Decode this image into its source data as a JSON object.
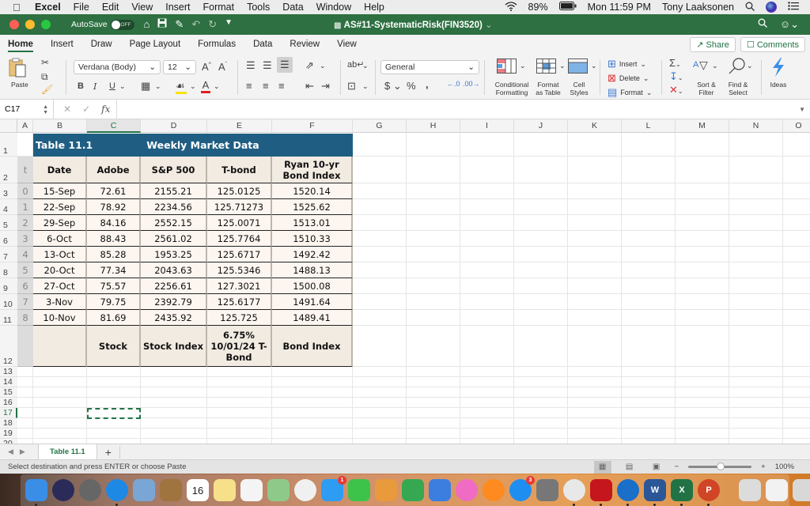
{
  "menubar": {
    "app": "Excel",
    "items": [
      "File",
      "Edit",
      "View",
      "Insert",
      "Format",
      "Tools",
      "Data",
      "Window",
      "Help"
    ],
    "battery": "89%",
    "clock": "Mon 11:59 PM",
    "user": "Tony Laaksonen"
  },
  "titlebar": {
    "autosave_label": "AutoSave",
    "autosave_state": "OFF",
    "document_title": "AS#11-SystematicRisk(FIN3520)"
  },
  "ribbon": {
    "tabs": [
      "Home",
      "Insert",
      "Draw",
      "Page Layout",
      "Formulas",
      "Data",
      "Review",
      "View"
    ],
    "active_tab": "Home",
    "share_label": "Share",
    "comments_label": "Comments",
    "paste_label": "Paste",
    "font_name": "Verdana (Body)",
    "font_size": "12",
    "number_format": "General",
    "conditional_formatting": "Conditional Formatting",
    "format_as_table": "Format as Table",
    "cell_styles": "Cell Styles",
    "insert_label": "Insert",
    "delete_label": "Delete",
    "format_label": "Format",
    "sort_filter": "Sort & Filter",
    "find_select": "Find & Select",
    "ideas": "Ideas",
    "colors": {
      "highlight": "#f5e400",
      "font_color": "#e02020"
    }
  },
  "formula_bar": {
    "name_box": "C17",
    "fx": "fx",
    "content": ""
  },
  "grid": {
    "columns": [
      "A",
      "B",
      "C",
      "D",
      "E",
      "F",
      "G",
      "H",
      "I",
      "J",
      "K",
      "L",
      "M",
      "N",
      "O"
    ],
    "active_column": "C",
    "rows": [
      "1",
      "2",
      "3",
      "4",
      "5",
      "6",
      "7",
      "8",
      "9",
      "10",
      "11",
      "12",
      "13",
      "14",
      "15",
      "16",
      "17",
      "18",
      "19",
      "20"
    ],
    "active_row": "17",
    "selected_cell": "C17"
  },
  "table": {
    "title_left": "Table 11.1",
    "title_right": "Weekly Market Data",
    "headers": [
      "t",
      "Date",
      "Adobe",
      "S&P 500",
      "T-bond",
      "Ryan 10-yr Bond Index"
    ],
    "rows": [
      [
        "0",
        "15-Sep",
        "72.61",
        "2155.21",
        "125.0125",
        "1520.14"
      ],
      [
        "1",
        "22-Sep",
        "78.92",
        "2234.56",
        "125.71273",
        "1525.62"
      ],
      [
        "2",
        "29-Sep",
        "84.16",
        "2552.15",
        "125.0071",
        "1513.01"
      ],
      [
        "3",
        "6-Oct",
        "88.43",
        "2561.02",
        "125.7764",
        "1510.33"
      ],
      [
        "4",
        "13-Oct",
        "85.28",
        "1953.25",
        "125.6717",
        "1492.42"
      ],
      [
        "5",
        "20-Oct",
        "77.34",
        "2043.63",
        "125.5346",
        "1488.13"
      ],
      [
        "6",
        "27-Oct",
        "75.57",
        "2256.61",
        "127.3021",
        "1500.08"
      ],
      [
        "7",
        "3-Nov",
        "79.75",
        "2392.79",
        "125.6177",
        "1491.64"
      ],
      [
        "8",
        "10-Nov",
        "81.69",
        "2435.92",
        "125.725",
        "1489.41"
      ]
    ],
    "footer": [
      "",
      "",
      "Stock",
      "Stock Index",
      "6.75% 10/01/24 T-Bond",
      "Bond Index"
    ],
    "colors": {
      "title_bg": "#1f5e82",
      "header_bg": "#f2ebe2",
      "data_bg": "#fdf6f0"
    }
  },
  "sheets": {
    "tabs": [
      "Table 11.1"
    ],
    "active": "Table 11.1",
    "add_label": "+"
  },
  "status": {
    "message": "Select destination and press ENTER or choose Paste",
    "zoom": "100%",
    "zoom_value": 100
  },
  "dock": {
    "apps": [
      {
        "name": "Finder",
        "color": "#3a8ee6"
      },
      {
        "name": "Siri",
        "color": "#2b2b5a"
      },
      {
        "name": "Launchpad",
        "color": "#666"
      },
      {
        "name": "Safari",
        "color": "#1e88e5"
      },
      {
        "name": "Mail Preview",
        "color": "#7aa6d6"
      },
      {
        "name": "Contacts",
        "color": "#a0743f"
      },
      {
        "name": "Calendar",
        "color": "#ffffff",
        "text": "16"
      },
      {
        "name": "Notes",
        "color": "#f7e08a"
      },
      {
        "name": "Reminders",
        "color": "#f4f4f4"
      },
      {
        "name": "Maps",
        "color": "#8fc98a"
      },
      {
        "name": "Photos",
        "color": "#f0f0f0"
      },
      {
        "name": "Messages",
        "color": "#2f9cf4",
        "badge": "1"
      },
      {
        "name": "FaceTime",
        "color": "#3ec34a"
      },
      {
        "name": "Pages-like",
        "color": "#e89a3c"
      },
      {
        "name": "Numbers",
        "color": "#36a852"
      },
      {
        "name": "Keynote",
        "color": "#3b7ee0"
      },
      {
        "name": "iTunes",
        "color": "#f06bc3"
      },
      {
        "name": "Books",
        "color": "#ff8a1f"
      },
      {
        "name": "App Store",
        "color": "#1f8ef1",
        "badge": "3"
      },
      {
        "name": "System Preferences",
        "color": "#777"
      },
      {
        "name": "Chrome",
        "color": "#e8e8e8"
      },
      {
        "name": "Acrobat",
        "color": "#c4161c"
      },
      {
        "name": "Media Player",
        "color": "#1a6fc8"
      },
      {
        "name": "Word",
        "color": "#2b5797",
        "text": "W"
      },
      {
        "name": "Excel",
        "color": "#217346",
        "text": "X"
      },
      {
        "name": "PowerPoint",
        "color": "#d04525",
        "text": "P"
      }
    ],
    "trailing": [
      {
        "name": "Screenshot Folder",
        "color": "#dcdcdc"
      },
      {
        "name": "PNG File",
        "color": "#f2f2f2"
      },
      {
        "name": "Trash",
        "color": "#d8d8d8"
      }
    ]
  }
}
